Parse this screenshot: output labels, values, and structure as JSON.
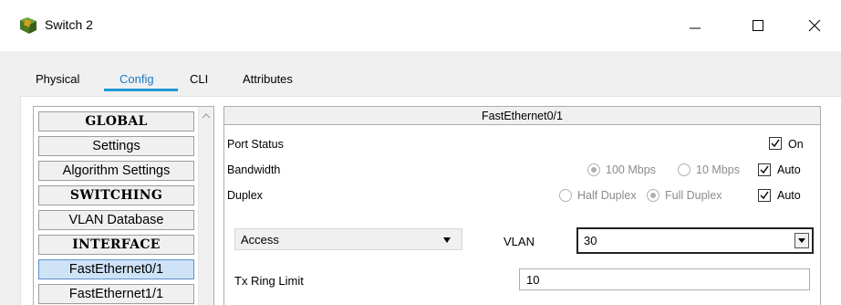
{
  "window": {
    "title": "Switch 2",
    "icon": "switch-device-icon"
  },
  "tabs": [
    {
      "label": "Physical",
      "active": false
    },
    {
      "label": "Config",
      "active": true
    },
    {
      "label": "CLI",
      "active": false
    },
    {
      "label": "Attributes",
      "active": false
    }
  ],
  "sidebar": {
    "items": [
      {
        "label": "GLOBAL",
        "type": "header"
      },
      {
        "label": "Settings",
        "type": "item"
      },
      {
        "label": "Algorithm Settings",
        "type": "item"
      },
      {
        "label": "SWITCHING",
        "type": "header"
      },
      {
        "label": "VLAN Database",
        "type": "item"
      },
      {
        "label": "INTERFACE",
        "type": "header"
      },
      {
        "label": "FastEthernet0/1",
        "type": "item",
        "selected": true
      },
      {
        "label": "FastEthernet1/1",
        "type": "item"
      }
    ]
  },
  "panel": {
    "title": "FastEthernet0/1",
    "port_status": {
      "label": "Port Status",
      "on_label": "On",
      "on_checked": true
    },
    "bandwidth": {
      "label": "Bandwidth",
      "opt_100": "100 Mbps",
      "opt_10": "10 Mbps",
      "auto_label": "Auto",
      "selected": "100 Mbps",
      "auto_checked": true
    },
    "duplex": {
      "label": "Duplex",
      "opt_half": "Half Duplex",
      "opt_full": "Full Duplex",
      "auto_label": "Auto",
      "selected": "Full Duplex",
      "auto_checked": true
    },
    "mode": {
      "value": "Access"
    },
    "vlan": {
      "label": "VLAN",
      "value": "30"
    },
    "tx_ring": {
      "label": "Tx Ring Limit",
      "value": "10"
    }
  },
  "colors": {
    "tab_active": "#1c7ac8",
    "tab_underline": "#1e9ad6",
    "selected_item": "#cfe3f7"
  }
}
